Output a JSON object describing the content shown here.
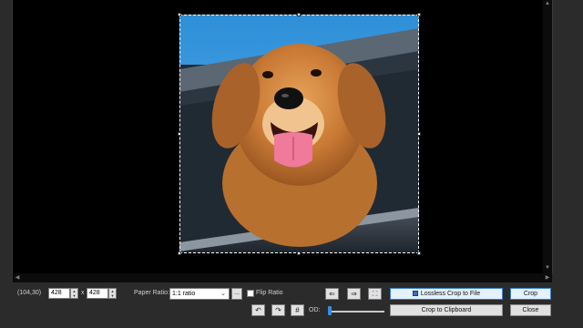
{
  "status": {
    "coordinates": "(104,30)"
  },
  "size": {
    "width": "428",
    "height": "428",
    "separator": "x"
  },
  "paper_ratio": {
    "label": "Paper Ratio:",
    "value": "1:1 ratio",
    "more": "..."
  },
  "flip_ratio": {
    "label": "Flip Ratio",
    "checked": false
  },
  "buttons": {
    "lossless_crop": "Lossless Crop to File",
    "crop": "Crop",
    "crop_clipboard": "Crop to Clipboard",
    "close": "Close"
  },
  "od": {
    "label": "OD:",
    "value": 0.0
  },
  "icons": {
    "rotate_left": "rotate-left-icon",
    "rotate_right": "rotate-right-icon",
    "fit": "fit-selection-icon",
    "undo_rotate": "rotate-ccw-icon",
    "redo_rotate": "rotate-cw-icon",
    "grid": "grid-icon"
  },
  "colors": {
    "accent": "#3b8be0",
    "canvas": "#000000",
    "panel": "#2b2b2b"
  }
}
